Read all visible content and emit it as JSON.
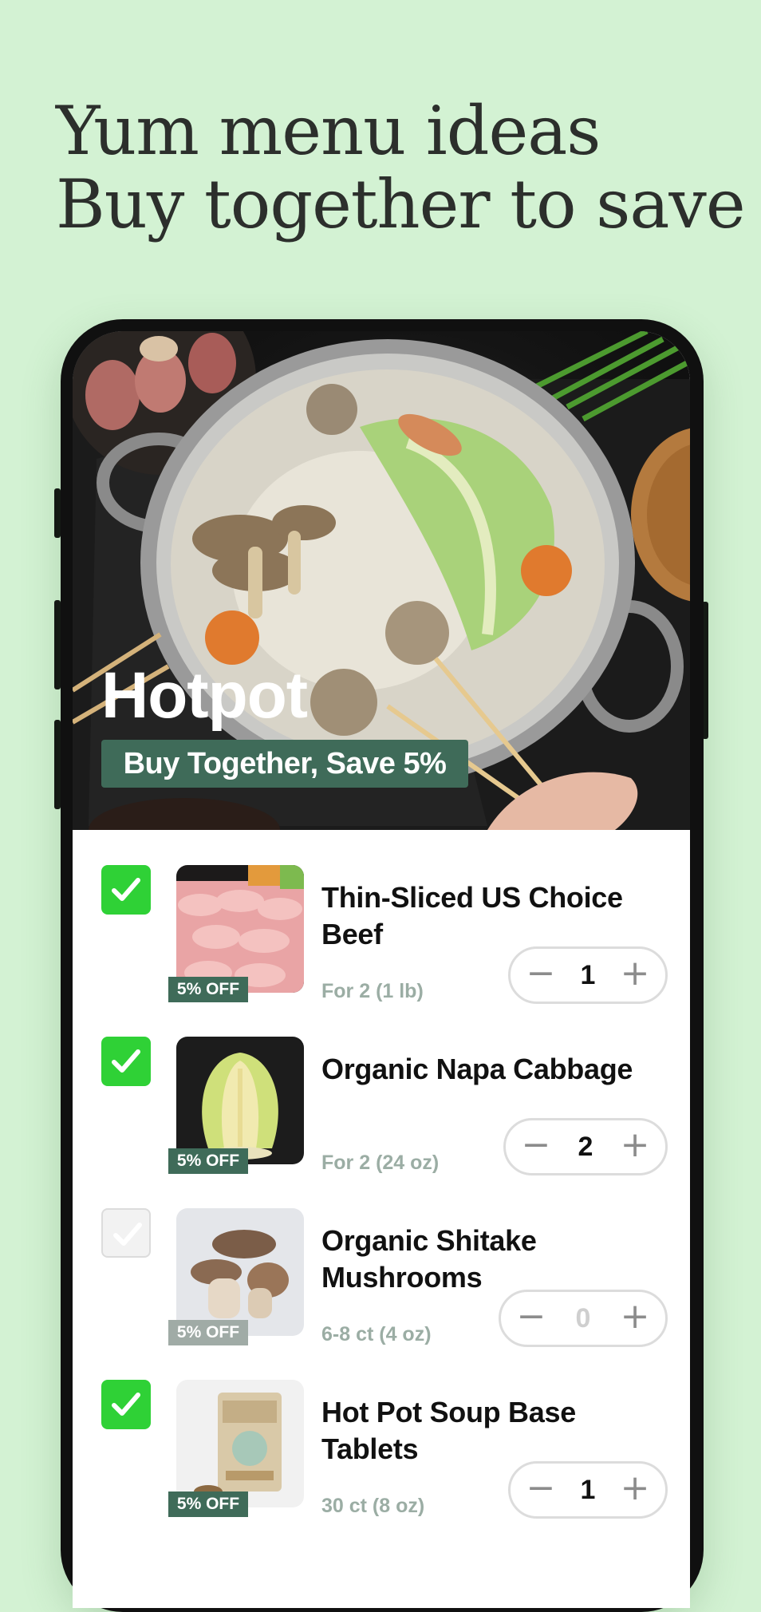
{
  "headline": {
    "line1": "Yum menu ideas",
    "line2": "Buy together to save"
  },
  "hero": {
    "title": "Hotpot",
    "badge": "Buy Together, Save 5%"
  },
  "colors": {
    "background": "#d3f2d3",
    "accent_green": "#3f6b59",
    "check_green": "#2fd136",
    "muted_text": "#9bada4"
  },
  "items": [
    {
      "name": "Thin-Sliced US Choice Beef",
      "size": "For 2 (1 lb)",
      "discount": "5% OFF",
      "quantity": "1",
      "checked": true,
      "image": "sliced-beef"
    },
    {
      "name": "Organic Napa Cabbage",
      "size": "For 2 (24 oz)",
      "discount": "5% OFF",
      "quantity": "2",
      "checked": true,
      "image": "napa-cabbage"
    },
    {
      "name": "Organic Shitake Mushrooms",
      "size": "6-8 ct (4 oz)",
      "discount": "5% OFF",
      "quantity": "0",
      "checked": false,
      "image": "shitake-mushrooms"
    },
    {
      "name": "Hot Pot Soup Base Tablets",
      "size": "30 ct (8 oz)",
      "discount": "5% OFF",
      "quantity": "1",
      "checked": true,
      "image": "soup-base-package"
    }
  ],
  "stepper": {
    "minus_icon": "minus-icon",
    "plus_icon": "plus-icon"
  }
}
